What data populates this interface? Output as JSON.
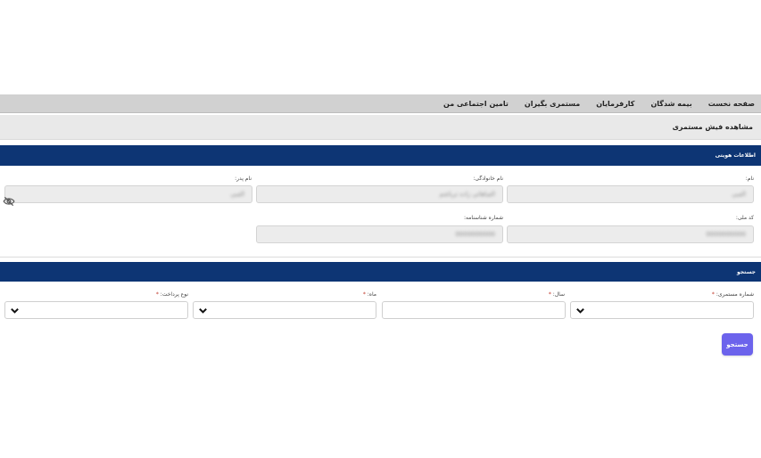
{
  "nav": {
    "items": [
      {
        "label": "صفحه نخست"
      },
      {
        "label": "بیمه شدگان"
      },
      {
        "label": "کارفرمایان"
      },
      {
        "label": "مستمری بگیران"
      },
      {
        "label": "تامین اجتماعی من"
      }
    ]
  },
  "page": {
    "title": "مشاهده فیش مستمری"
  },
  "identity": {
    "header": "اطلاعات هویتی",
    "first_name": {
      "label": "نام:",
      "value": "الفبی"
    },
    "last_name": {
      "label": "نام خانوادگی:",
      "value": "الفباهاتی زاده تریاشم"
    },
    "father_name": {
      "label": "نام پدر:",
      "value": "الفبی"
    },
    "national_code": {
      "label": "کد ملی:",
      "value": "0000000000"
    },
    "id_number": {
      "label": "شماره شناسنامه:",
      "value": "0000000000"
    }
  },
  "search": {
    "header": "جستجو",
    "pension_number": {
      "label": "شماره مستمری:",
      "required_mark": "*"
    },
    "year": {
      "label": "سال:",
      "required_mark": "*"
    },
    "month": {
      "label": "ماه:",
      "required_mark": "*"
    },
    "payment_type": {
      "label": "نوع پرداخت:",
      "required_mark": "*"
    },
    "button_label": "جستجو"
  },
  "colors": {
    "section_header": "#0d3574",
    "nav_bg": "#d1d1d1",
    "button_bg": "#6c63ec"
  },
  "icons": {
    "password_toggle": "eye-slash-icon",
    "select_arrow": "chevron-down-icon"
  }
}
